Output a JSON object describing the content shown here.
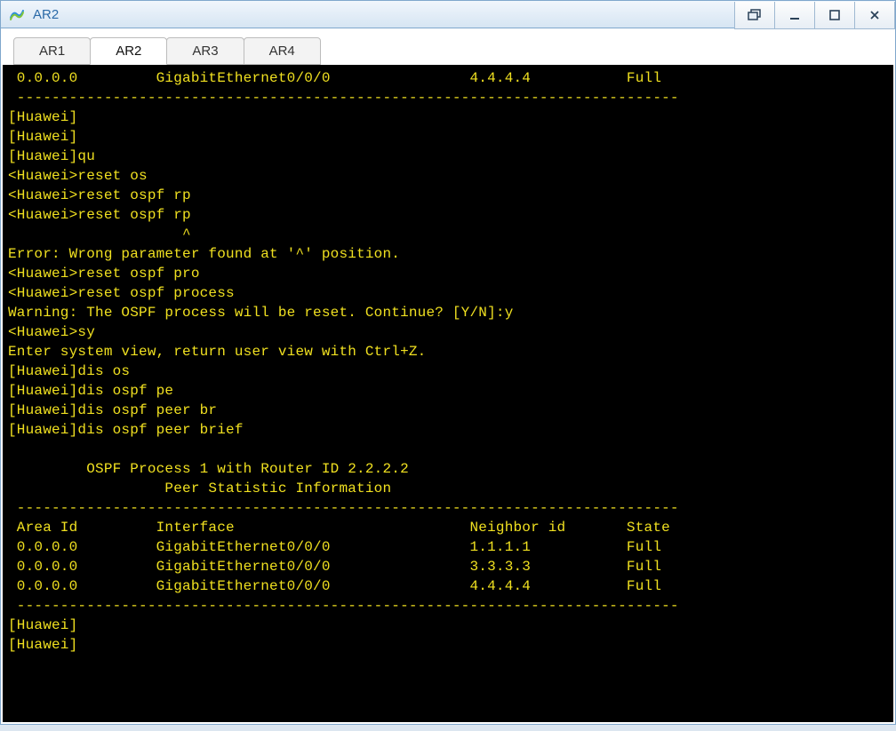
{
  "window": {
    "title": "AR2"
  },
  "tabs": [
    {
      "label": "AR1",
      "active": false
    },
    {
      "label": "AR2",
      "active": true
    },
    {
      "label": "AR3",
      "active": false
    },
    {
      "label": "AR4",
      "active": false
    }
  ],
  "terminal": {
    "top_row": {
      "area_id": "0.0.0.0",
      "interface": "GigabitEthernet0/0/0",
      "neighbor": "4.4.4.4",
      "state": "Full"
    },
    "dashes": "----------------------------------------------------------------------------",
    "body_lines": [
      "[Huawei]",
      "[Huawei]",
      "[Huawei]qu",
      "<Huawei>reset os",
      "<Huawei>reset ospf rp",
      "<Huawei>reset ospf rp",
      "                    ^",
      "Error: Wrong parameter found at '^' position.",
      "<Huawei>reset ospf pro",
      "<Huawei>reset ospf process",
      "Warning: The OSPF process will be reset. Continue? [Y/N]:y",
      "<Huawei>sy",
      "Enter system view, return user view with Ctrl+Z.",
      "[Huawei]dis os",
      "[Huawei]dis ospf pe",
      "[Huawei]dis ospf peer br",
      "[Huawei]dis ospf peer brief",
      "",
      "         OSPF Process 1 with Router ID 2.2.2.2",
      "                  Peer Statistic Information"
    ],
    "table_header": {
      "col1": "Area Id",
      "col2": "Interface",
      "col3": "Neighbor id",
      "col4": "State"
    },
    "table_rows": [
      {
        "area_id": "0.0.0.0",
        "interface": "GigabitEthernet0/0/0",
        "neighbor": "1.1.1.1",
        "state": "Full"
      },
      {
        "area_id": "0.0.0.0",
        "interface": "GigabitEthernet0/0/0",
        "neighbor": "3.3.3.3",
        "state": "Full"
      },
      {
        "area_id": "0.0.0.0",
        "interface": "GigabitEthernet0/0/0",
        "neighbor": "4.4.4.4",
        "state": "Full"
      }
    ],
    "tail_lines": [
      "[Huawei]",
      "[Huawei]"
    ]
  }
}
